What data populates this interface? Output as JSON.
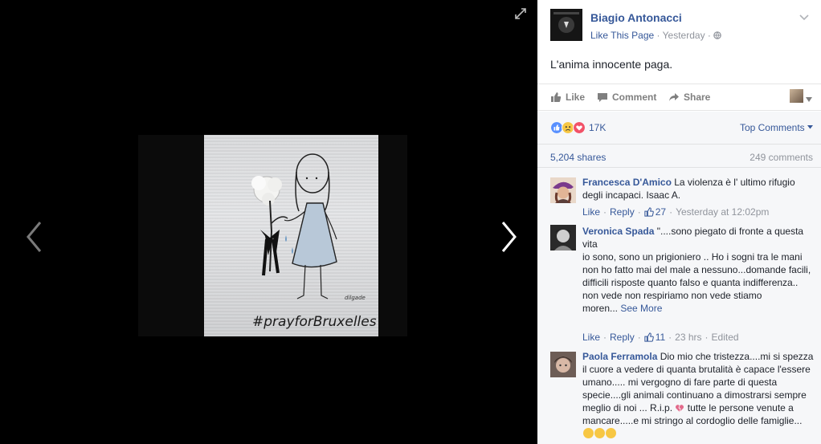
{
  "post": {
    "page_name": "Biagio Antonacci",
    "like_page": "Like This Page",
    "separator": "·",
    "time": "Yesterday",
    "text": "L'anima innocente paga."
  },
  "actions": {
    "like": "Like",
    "comment": "Comment",
    "share": "Share"
  },
  "reactions": {
    "count": "17K",
    "sort": "Top Comments"
  },
  "stats": {
    "shares": "5,204 shares",
    "comments": "249 comments"
  },
  "photo": {
    "hashtag": "#prayforBruxelles",
    "signature": "dilgade"
  },
  "comments": [
    {
      "author": "Francesca D'Amico",
      "text": "La violenza è l' ultimo rifugio degli incapaci. Isaac A.",
      "like": "Like",
      "reply": "Reply",
      "likes": "27",
      "time": "Yesterday at 12:02pm"
    },
    {
      "author": "Veronica Spada",
      "text": "\"....sono piegato di fronte a questa vita",
      "lines": [
        "io sono, sono un prigioniero .. Ho i sogni tra le mani",
        "non ho fatto mai del male a nessuno...domande facili, difficili risposte quanto falso e quanta indifferenza..",
        "non vede non respiriamo non vede stiamo"
      ],
      "last_line": "moren...",
      "see_more": "See More",
      "like": "Like",
      "reply": "Reply",
      "likes": "11",
      "time": "23 hrs",
      "edited": "Edited"
    },
    {
      "author": "Paola Ferramola",
      "text": "Dio mio che tristezza....mi si spezza il cuore a vedere di quanta brutalità è capace l'essere umano..... mi vergogno di fare parte di questa specie....gli animali continuano a dimostrarsi sempre meglio di noi ... R.i.p.",
      "text2": "tutte le persone venute a mancare.....e mi stringo al cordoglio delle famiglie..."
    }
  ],
  "colors": {
    "link": "#365899",
    "muted": "#90949c",
    "love": "#f25268",
    "like": "#5890ff"
  }
}
